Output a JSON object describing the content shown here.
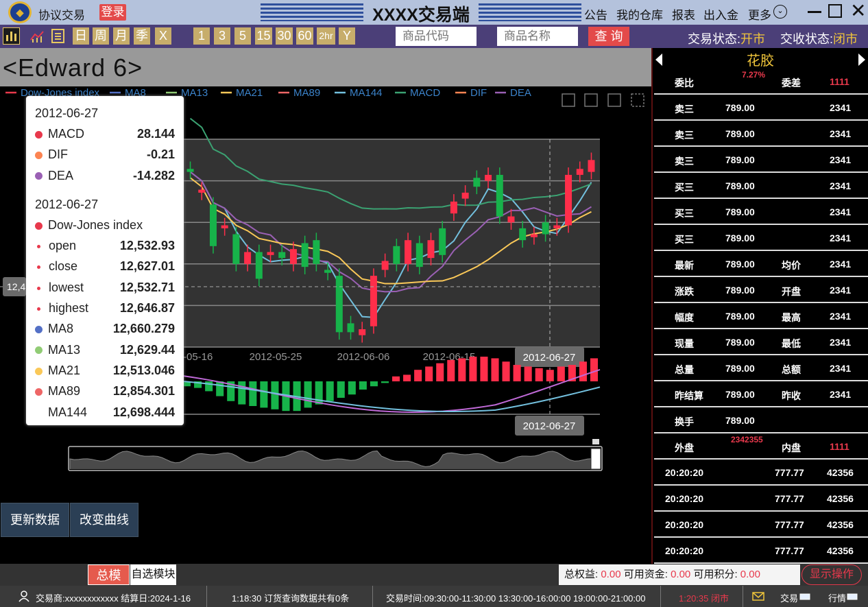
{
  "header": {
    "logo_text": "◆",
    "app_name": "协议交易",
    "login_label": "登录",
    "title": "XXXX交易端",
    "menu": [
      "公告",
      "我的仓库",
      "报表",
      "出入金",
      "更多"
    ],
    "more_glyph": "⌄",
    "close_glyph": "✕"
  },
  "toolbar": {
    "icons": [
      "bar-chart-icon",
      "indicator-icon",
      "list-icon"
    ],
    "period_buttons": [
      "日",
      "周",
      "月",
      "季",
      "X"
    ],
    "minute_buttons": [
      "1",
      "3",
      "5",
      "15",
      "30",
      "60",
      "2hr",
      "Y"
    ],
    "code_placeholder": "商品代码",
    "name_placeholder": "商品名称",
    "query_label": "查 询",
    "trade_status_label": "交易状态:",
    "trade_status_value": "开市",
    "delivery_status_label": "交收状态:",
    "delivery_status_value": "闭市"
  },
  "chart_title": "<Edward 6>",
  "legend": {
    "items": [
      {
        "name": "Dow-Jones index",
        "color": "#e8394c"
      },
      {
        "name": "MA8",
        "color": "#5470c6"
      },
      {
        "name": "MA13",
        "color": "#91cc75"
      },
      {
        "name": "MA21",
        "color": "#fac858"
      },
      {
        "name": "MA89",
        "color": "#ee6666"
      },
      {
        "name": "MA144",
        "color": "#73c0de"
      },
      {
        "name": "MACD",
        "color": "#3ba272"
      },
      {
        "name": "DIF",
        "color": "#fc8452"
      },
      {
        "name": "DEA",
        "color": "#9a60b4"
      }
    ]
  },
  "chart_data": {
    "type": "candlestick",
    "x_ticks": [
      "2012-05-16",
      "2012-05-25",
      "2012-06-06",
      "2012-06-15",
      "2012-06-27"
    ],
    "y_pointer_label": "12,4",
    "crosshair_date": "2012-06-27",
    "candles": [
      {
        "o": 12800,
        "c": 12790
      },
      {
        "o": 12720,
        "c": 12730
      },
      {
        "o": 12680,
        "c": 12540
      },
      {
        "o": 12600,
        "c": 12610
      },
      {
        "o": 12580,
        "c": 12480
      },
      {
        "o": 12480,
        "c": 12520
      },
      {
        "o": 12520,
        "c": 12430
      },
      {
        "o": 12510,
        "c": 12520
      },
      {
        "o": 12520,
        "c": 12500
      },
      {
        "o": 12480,
        "c": 12530
      },
      {
        "o": 12550,
        "c": 12470
      },
      {
        "o": 12560,
        "c": 12480
      },
      {
        "o": 12460,
        "c": 12450
      },
      {
        "o": 12440,
        "c": 12250
      },
      {
        "o": 12280,
        "c": 12250
      },
      {
        "o": 12240,
        "c": 12260
      },
      {
        "o": 12270,
        "c": 12440
      },
      {
        "o": 12460,
        "c": 12490
      },
      {
        "o": 12540,
        "c": 12480
      },
      {
        "o": 12480,
        "c": 12560
      },
      {
        "o": 12550,
        "c": 12470
      },
      {
        "o": 12500,
        "c": 12560
      },
      {
        "o": 12600,
        "c": 12510
      },
      {
        "o": 12650,
        "c": 12690
      },
      {
        "o": 12700,
        "c": 12720
      },
      {
        "o": 12770,
        "c": 12740
      },
      {
        "o": 12760,
        "c": 12780
      },
      {
        "o": 12780,
        "c": 12640
      },
      {
        "o": 12620,
        "c": 12640
      },
      {
        "o": 12600,
        "c": 12560
      },
      {
        "o": 12570,
        "c": 12580
      },
      {
        "o": 12620,
        "c": 12580
      },
      {
        "o": 12600,
        "c": 12610
      },
      {
        "o": 12610,
        "c": 12780
      },
      {
        "o": 12780,
        "c": 12800
      },
      {
        "o": 12790,
        "c": 12830
      }
    ],
    "macd": [
      -3,
      -4,
      -6,
      -9,
      -12,
      -14,
      -15,
      -16,
      -17,
      -18,
      -18,
      -16,
      -14,
      -12,
      -10,
      -8,
      -5,
      -3,
      -1,
      3,
      4,
      7,
      9,
      11,
      13,
      14,
      15,
      15,
      14,
      12,
      10,
      9,
      8,
      7,
      9,
      10,
      12,
      14
    ],
    "tooltip": {
      "macd_date": "2012-06-27",
      "macd_rows": [
        {
          "name": "MACD",
          "value": "28.144",
          "color": "#e8394c"
        },
        {
          "name": "DIF",
          "value": "-0.21",
          "color": "#fc8452"
        },
        {
          "name": "DEA",
          "value": "-14.282",
          "color": "#9a60b4"
        }
      ],
      "kline_date": "2012-06-27",
      "series_name": "Dow-Jones index",
      "ohlc_rows": [
        {
          "name": "open",
          "value": "12,532.93"
        },
        {
          "name": "close",
          "value": "12,627.01"
        },
        {
          "name": "lowest",
          "value": "12,532.71"
        },
        {
          "name": "highest",
          "value": "12,646.87"
        }
      ],
      "ma_rows": [
        {
          "name": "MA8",
          "value": "12,660.279",
          "color": "#5470c6"
        },
        {
          "name": "MA13",
          "value": "12,629.44",
          "color": "#91cc75"
        },
        {
          "name": "MA21",
          "value": "12,513.046",
          "color": "#fac858"
        },
        {
          "name": "MA89",
          "value": "12,854.301",
          "color": "#ee6666"
        },
        {
          "name": "MA144",
          "value": "12,698.444",
          "color": ""
        }
      ]
    }
  },
  "actions": {
    "refresh_label": "更新数据",
    "change_curve_label": "改变曲线"
  },
  "right_panel": {
    "title": "花胶",
    "ratio_row": {
      "left_label": "委比",
      "left_value": "7.27%",
      "right_label": "委差",
      "right_value": "1111"
    },
    "order_rows": [
      {
        "label": "卖三",
        "price": "789.00",
        "volume": "2341"
      },
      {
        "label": "卖三",
        "price": "789.00",
        "volume": "2341"
      },
      {
        "label": "卖三",
        "price": "789.00",
        "volume": "2341"
      },
      {
        "label": "买三",
        "price": "789.00",
        "volume": "2341"
      },
      {
        "label": "买三",
        "price": "789.00",
        "volume": "2341"
      },
      {
        "label": "买三",
        "price": "789.00",
        "volume": "2341"
      }
    ],
    "stat_rows": [
      {
        "l1": "最新",
        "v1": "789.00",
        "l2": "均价",
        "v2": "2341"
      },
      {
        "l1": "涨跌",
        "v1": "789.00",
        "l2": "开盘",
        "v2": "2341"
      },
      {
        "l1": "幅度",
        "v1": "789.00",
        "l2": "最高",
        "v2": "2341"
      },
      {
        "l1": "现量",
        "v1": "789.00",
        "l2": "最低",
        "v2": "2341"
      },
      {
        "l1": "总量",
        "v1": "789.00",
        "l2": "总额",
        "v2": "2341"
      },
      {
        "l1": "昨结算",
        "v1": "789.00",
        "l2": "昨收",
        "v2": "2341"
      },
      {
        "l1": "换手",
        "v1": "789.00",
        "l2": "",
        "v2": ""
      }
    ],
    "inout_row": {
      "left_label": "外盘",
      "left_value": "2342355",
      "right_label": "内盘",
      "right_value": "1111"
    },
    "ticks": [
      {
        "time": "20:20:20",
        "price": "777.77",
        "volume": "42356"
      },
      {
        "time": "20:20:20",
        "price": "777.77",
        "volume": "42356"
      },
      {
        "time": "20:20:20",
        "price": "777.77",
        "volume": "42356"
      },
      {
        "time": "20:20:20",
        "price": "777.77",
        "volume": "42356"
      }
    ]
  },
  "bottom": {
    "tab_main": "总模",
    "tab_custom": "自选模块",
    "equity_label": "总权益:",
    "equity_value": "0.00",
    "funds_label": "可用资金:",
    "funds_value": "0.00",
    "points_label": "可用积分:",
    "points_value": "0.00",
    "show_ops_label": "显示操作"
  },
  "status_bar": {
    "broker": "交易商:xxxxxxxxxxxx 结算日:2024-1-16",
    "query_info": "1:18:30 订货查询数据共有0条",
    "trade_hours": "交易时间:09:30:00-11:30:00 13:30:00-16:00:00 19:00:00-21:00:00",
    "clock": "1:20:35 闭市",
    "trade_label": "交易",
    "quote_label": "行情"
  }
}
